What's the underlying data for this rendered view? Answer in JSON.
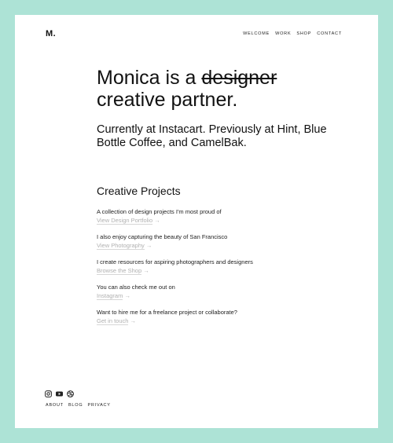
{
  "header": {
    "logo": "M.",
    "nav": [
      "WELCOME",
      "WORK",
      "SHOP",
      "CONTACT"
    ]
  },
  "hero": {
    "line1_prefix": "Monica is a ",
    "line1_strike": "designer",
    "line2": "creative partner.",
    "subtitle": "Currently at Instacart. Previously at Hint, Blue Bottle Coffee, and CamelBak."
  },
  "projects": {
    "heading": "Creative Projects",
    "items": [
      {
        "desc": "A collection of design projects I'm most proud of",
        "link": "View Design Portfolio"
      },
      {
        "desc": "I also enjoy capturing the beauty of San Francisco",
        "link": "View Photography"
      },
      {
        "desc": "I create resources for aspiring photographers and designers",
        "link": "Browse the Shop"
      },
      {
        "desc": "You can also check me out on",
        "link": "Instagram"
      },
      {
        "desc": "Want to hire me for a freelance project or collaborate?",
        "link": "Get in touch"
      }
    ],
    "arrow": "→"
  },
  "footer": {
    "social_icons": [
      "instagram-icon",
      "youtube-icon",
      "dribbble-icon"
    ],
    "links": [
      "ABOUT",
      "BLOG",
      "PRIVACY"
    ]
  },
  "colors": {
    "background": "#ade3d6",
    "page": "#ffffff",
    "text": "#111111",
    "link": "#b0b0b0"
  }
}
